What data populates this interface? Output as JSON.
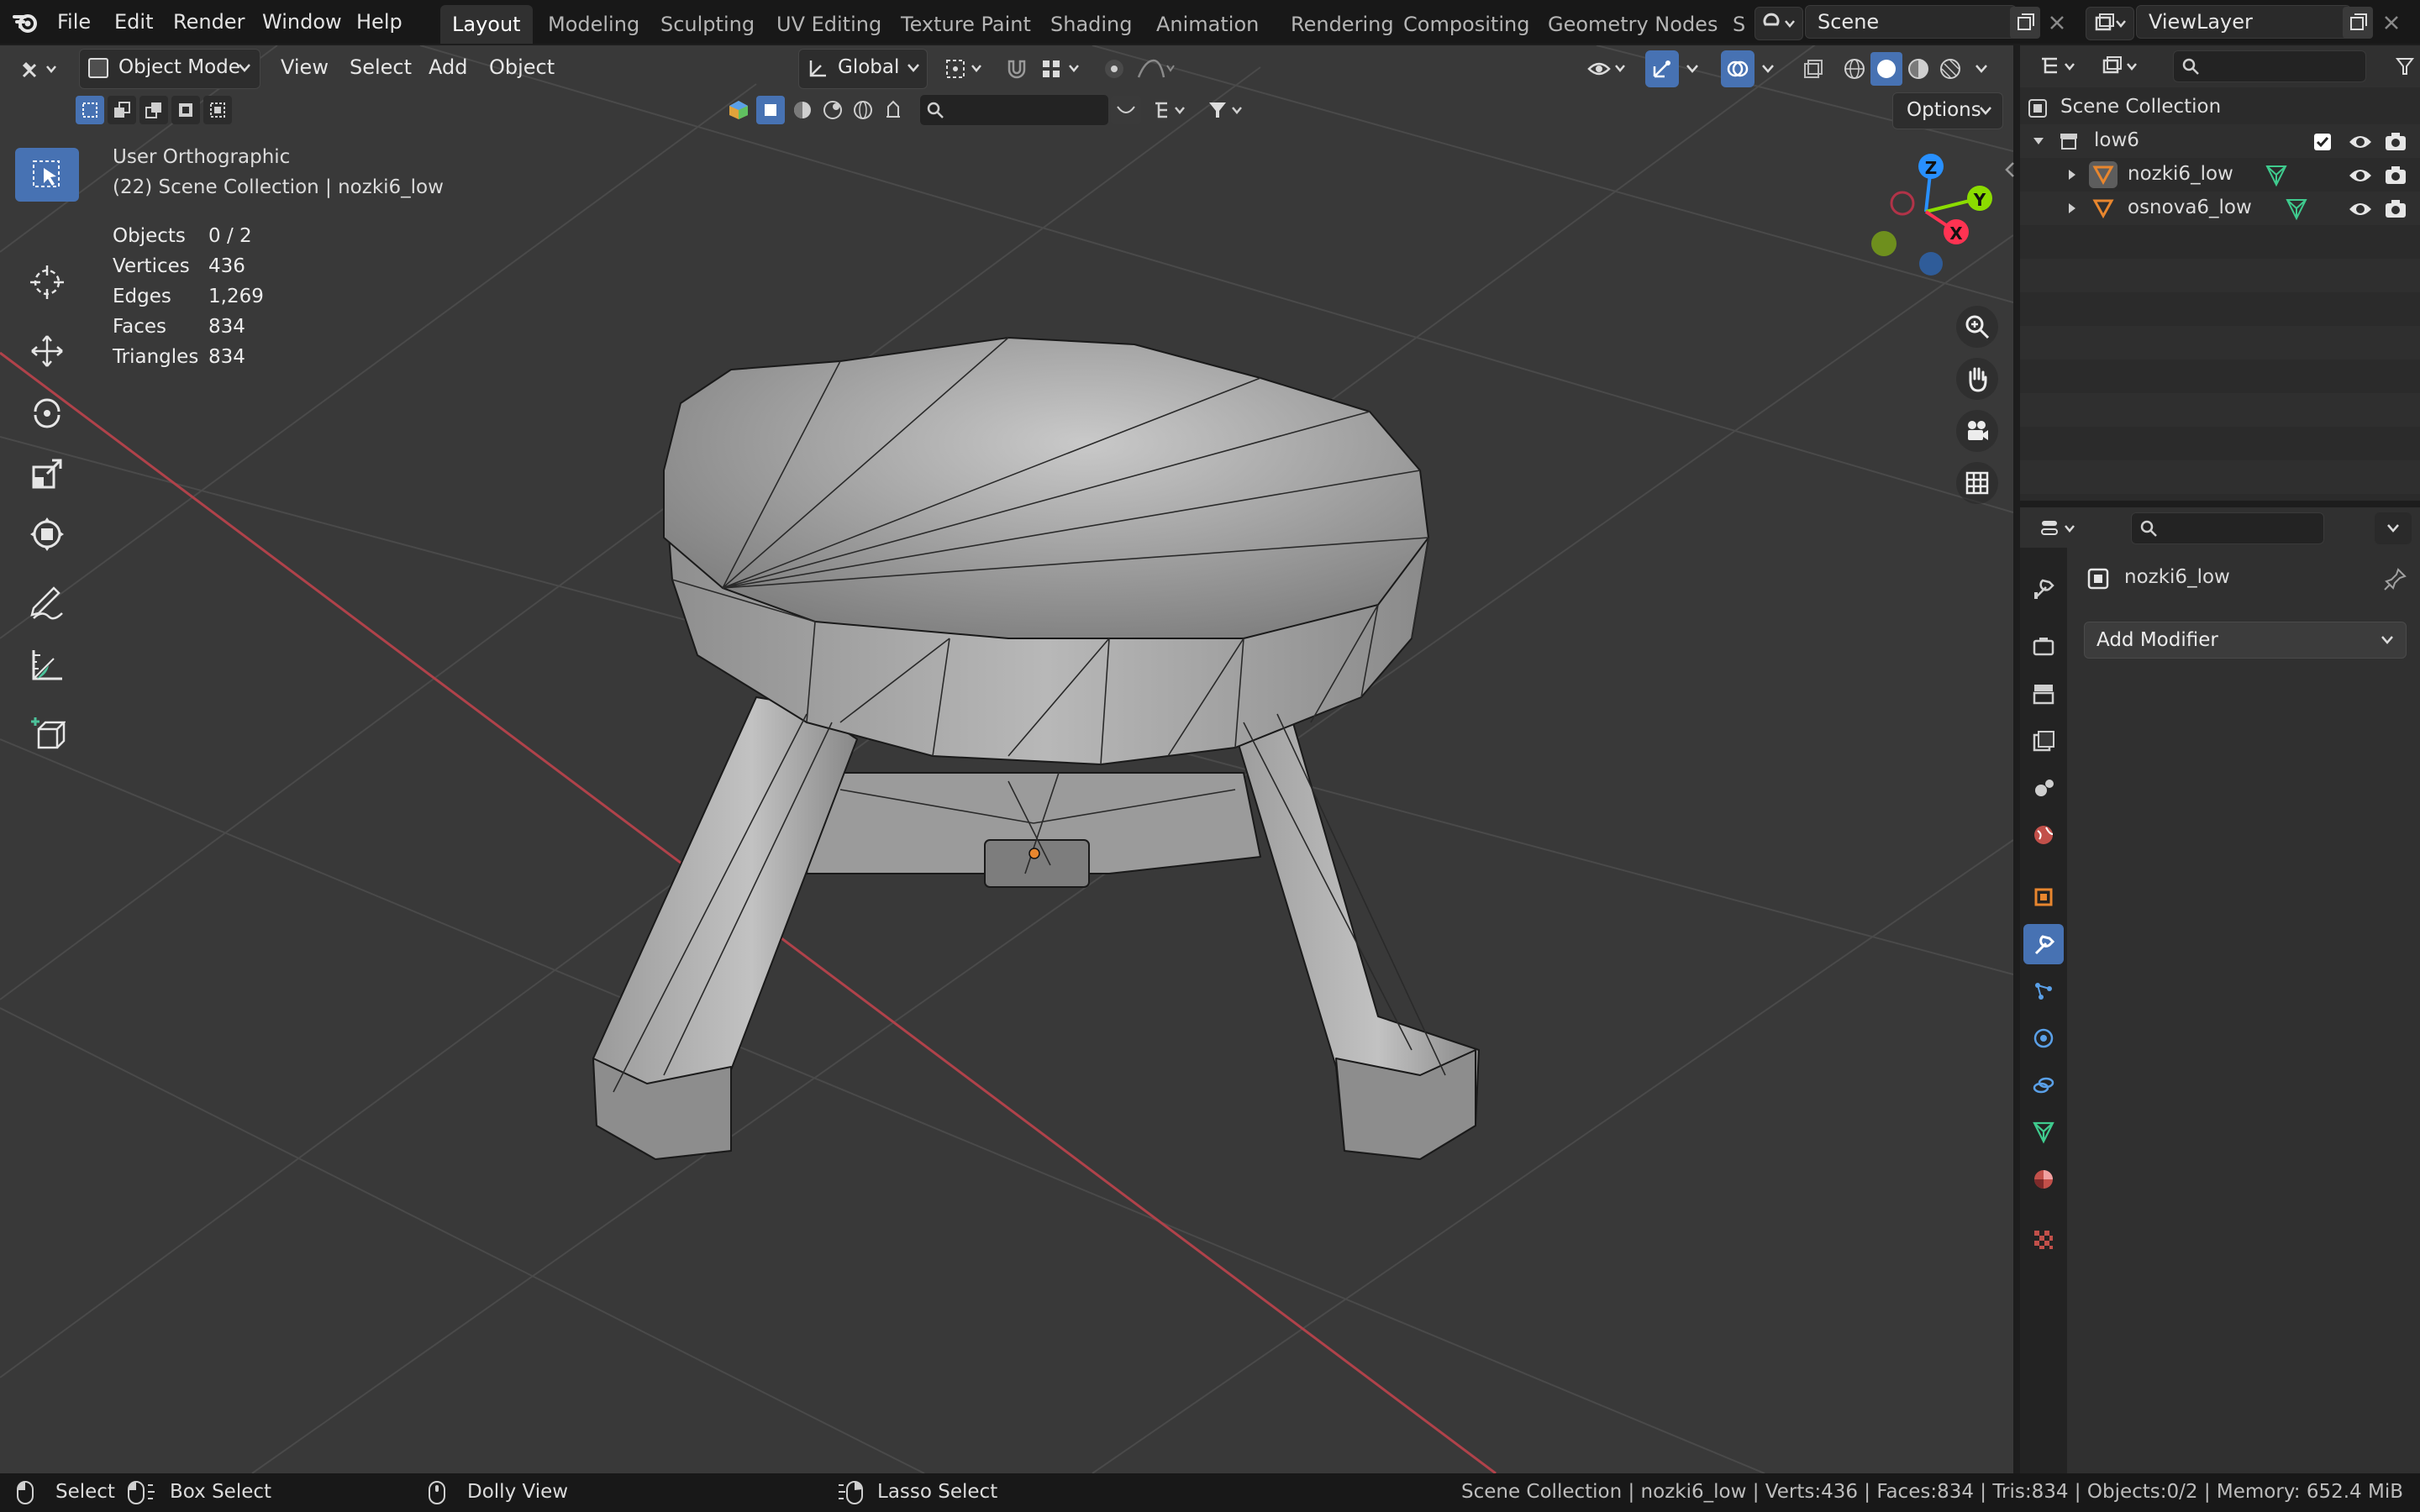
{
  "menubar": {
    "menus": [
      "File",
      "Edit",
      "Render",
      "Window",
      "Help"
    ],
    "workspaces": [
      "Layout",
      "Modeling",
      "Sculpting",
      "UV Editing",
      "Texture Paint",
      "Shading",
      "Animation",
      "Rendering",
      "Compositing",
      "Geometry Nodes",
      "S"
    ],
    "active_workspace": "Layout",
    "scene": "Scene",
    "view_layer": "ViewLayer"
  },
  "viewport_header": {
    "mode": "Object Mode",
    "menus": [
      "View",
      "Select",
      "Add",
      "Object"
    ],
    "orientation": "Global",
    "options_label": "Options"
  },
  "overlay_info": {
    "view_name": "User Orthographic",
    "collection_line": "(22) Scene Collection | nozki6_low",
    "stats": [
      {
        "label": "Objects",
        "value": "0 / 2"
      },
      {
        "label": "Vertices",
        "value": "436"
      },
      {
        "label": "Edges",
        "value": "1,269"
      },
      {
        "label": "Faces",
        "value": "834"
      },
      {
        "label": "Triangles",
        "value": "834"
      }
    ]
  },
  "gizmo": {
    "z": "Z",
    "y": "Y",
    "x": "X"
  },
  "outliner": {
    "root": "Scene Collection",
    "collection": "low6",
    "objects": [
      "nozki6_low",
      "osnova6_low"
    ]
  },
  "properties": {
    "object_name": "nozki6_low",
    "add_modifier": "Add Modifier"
  },
  "statusbar": {
    "select": "Select",
    "box_select": "Box Select",
    "dolly_view": "Dolly View",
    "lasso_select": "Lasso Select",
    "info": "Scene Collection | nozki6_low | Verts:436 | Faces:834 | Tris:834 | Objects:0/2 | Memory: 652.4 MiB"
  },
  "colors": {
    "accent": "#4772b3",
    "axis_x": "#ff3352",
    "axis_y": "#8bdc00",
    "axis_z": "#2890ff",
    "object_orange": "#e8862e",
    "mesh_green": "#3fcb8e"
  }
}
